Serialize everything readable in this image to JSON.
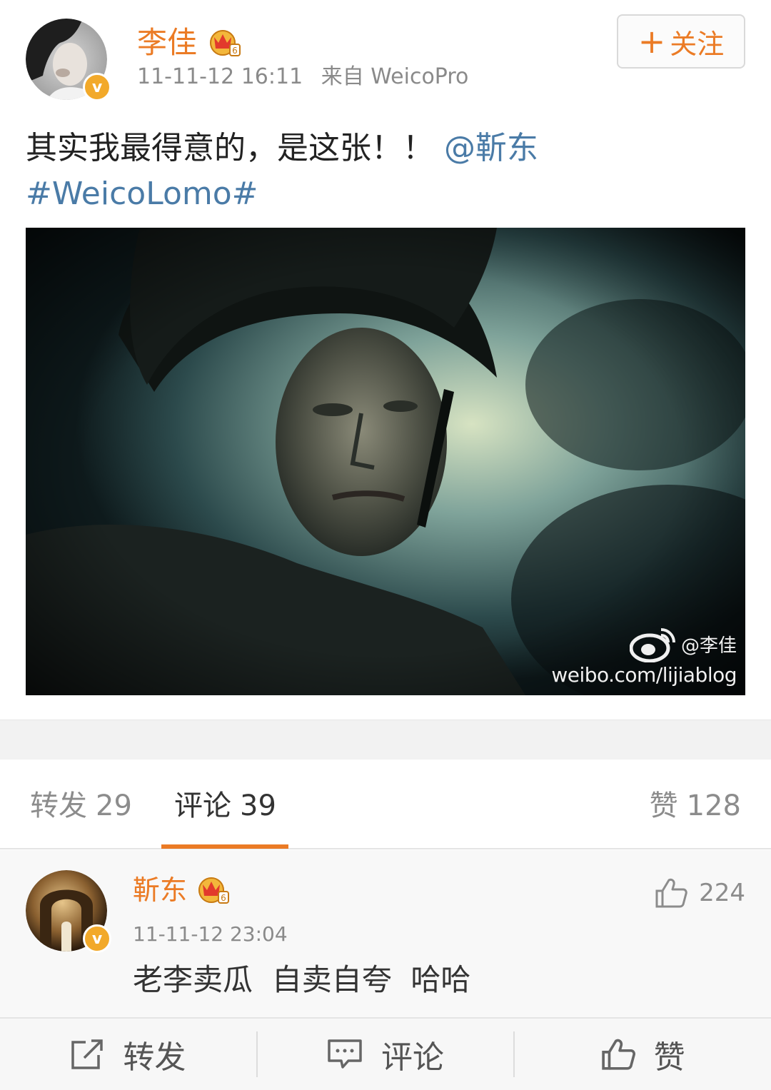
{
  "post": {
    "author": "李佳",
    "timestamp": "11-11-12 16:11",
    "source": "来自 WeicoPro",
    "follow_label": "关注",
    "text": "其实我最得意的，是这张！！",
    "mention": "@靳东",
    "hashtag": "#WeicoLomo#",
    "image": {
      "watermark_handle": "@李佳",
      "watermark_url": "weibo.com/lijiablog"
    }
  },
  "tabs": {
    "reposts_label": "转发",
    "reposts_count": "29",
    "comments_label": "评论",
    "comments_count": "39",
    "likes_label": "赞",
    "likes_count": "128",
    "active": "comments"
  },
  "comment": {
    "author": "靳东",
    "like_count": "224",
    "timestamp": "11-11-12 23:04",
    "text": "老李卖瓜  自卖自夸  哈哈"
  },
  "action_bar": {
    "repost_label": "转发",
    "comment_label": "评论",
    "like_label": "赞"
  },
  "colors": {
    "accent": "#eb7b25",
    "link": "#4a7ba7",
    "verified": "#f2a92a"
  },
  "icons": {
    "verified": "verified-badge-icon",
    "crown": "vip-crown-icon",
    "thumb": "thumbs-up-icon",
    "repost": "repost-icon",
    "comment": "comment-bubble-icon",
    "weibo": "weibo-logo-icon"
  }
}
